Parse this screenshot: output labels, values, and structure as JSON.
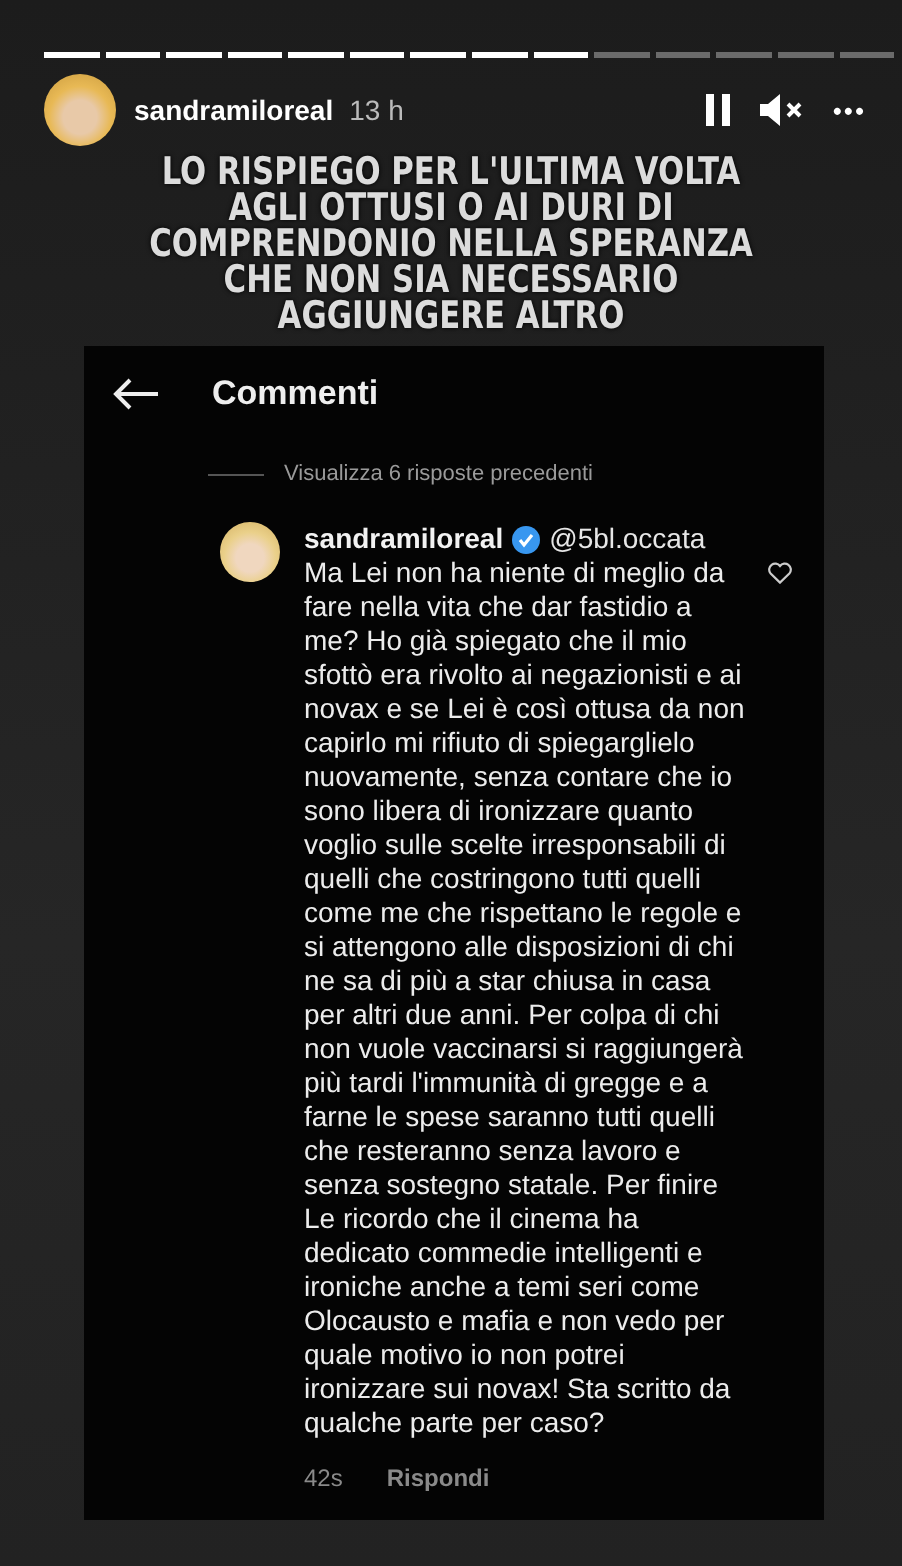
{
  "story": {
    "segments": [
      {
        "viewed": true
      },
      {
        "viewed": true
      },
      {
        "viewed": true
      },
      {
        "viewed": true
      },
      {
        "viewed": true
      },
      {
        "viewed": true
      },
      {
        "viewed": true
      },
      {
        "viewed": true
      },
      {
        "viewed": true
      },
      {
        "viewed": false
      },
      {
        "viewed": false
      },
      {
        "viewed": false
      },
      {
        "viewed": false
      },
      {
        "viewed": false
      }
    ],
    "username": "sandramiloreal",
    "time": "13 h",
    "playing": true,
    "muted": true,
    "more": "•••"
  },
  "caption": [
    "LO RISPIEGO PER L'ULTIMA VOLTA",
    "AGLI OTTUSI O AI DURI DI",
    "COMPRENDONIO NELLA SPERANZA",
    "CHE NON SIA NECESSARIO",
    "AGGIUNGERE ALTRO"
  ],
  "screenshot": {
    "title": "Commenti",
    "view_replies": "Visualizza 6 risposte precedenti",
    "comment": {
      "username": "sandramiloreal",
      "verified": true,
      "mention": "@5bl.occata",
      "liked": false,
      "text": "Ma Lei non ha niente di meglio da fare nella vita che dar fastidio a me? Ho già spiegato che il mio sfottò era rivolto ai negazionisti e ai novax e se Lei è così ottusa da non capirlo mi rifiuto di spiegarglielo nuovamente, senza contare che io sono libera di ironizzare quanto voglio sulle scelte irresponsabili di quelli che costringono tutti quelli come me che rispettano le regole e si attengono alle disposizioni di chi ne sa di più a star chiusa in casa per altri due anni. Per colpa di chi non vuole vaccinarsi si raggiungerà più tardi l'immunità di gregge e a farne le spese saranno tutti quelli che resteranno senza lavoro e senza sostegno statale. Per finire Le ricordo che il cinema ha dedicato commedie intelligenti e ironiche anche a temi seri come Olocausto e mafia e non vedo per quale motivo io non potrei ironizzare sui novax! Sta scritto da qualche parte per caso?",
      "time": "42s",
      "reply": "Rispondi"
    }
  }
}
